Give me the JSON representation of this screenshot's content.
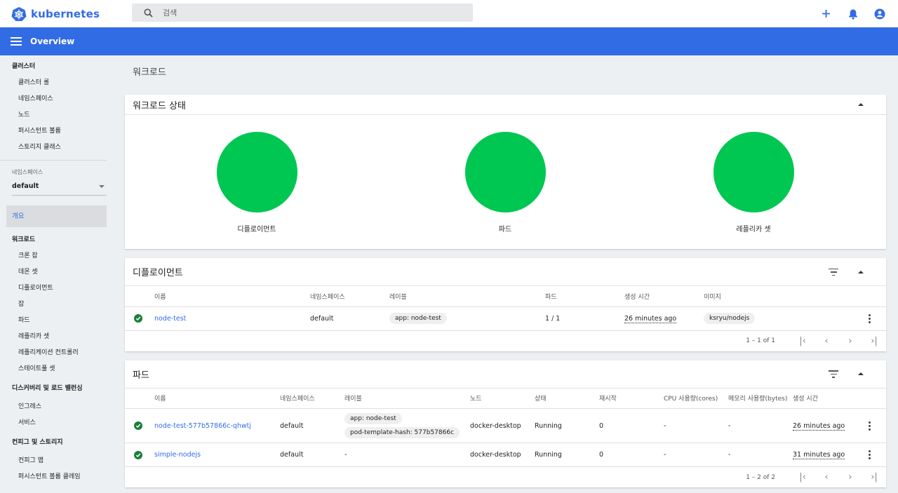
{
  "app": {
    "logo_text": "kubernetes",
    "brand_color": "#326ce5"
  },
  "search": {
    "placeholder": "검색"
  },
  "toolbar": {
    "title": "Overview"
  },
  "sidebar": {
    "cluster_head": "클러스터",
    "cluster_items": [
      "클러스터 롤",
      "네임스페이스",
      "노드",
      "퍼시스턴트 볼륨",
      "스토리지 클래스"
    ],
    "namespace_label": "네임스페이스",
    "namespace_value": "default",
    "active_item": "개요",
    "workload_head": "워크로드",
    "workload_items": [
      "크론 잡",
      "데몬 셋",
      "디플로이먼트",
      "잡",
      "파드",
      "레플리카 셋",
      "레플리케이션 컨트롤러",
      "스테이트풀 셋"
    ],
    "discovery_head": "디스커버리 및 로드 밸런싱",
    "discovery_items": [
      "인그레스",
      "서비스"
    ],
    "config_head": "컨피그 및 스토리지",
    "config_items": [
      "컨피그 맵",
      "퍼시스턴트 볼륨 클레임"
    ]
  },
  "main": {
    "page_title": "워크로드",
    "status_card": {
      "title": "워크로드 상태",
      "status_color": "#00c752",
      "items": [
        "디플로이먼트",
        "파드",
        "레플리카 셋"
      ]
    },
    "deployments": {
      "title": "디플로이먼트",
      "columns": [
        "이름",
        "네임스페이스",
        "레이블",
        "파드",
        "생성 시간",
        "이미지"
      ],
      "rows": [
        {
          "name": "node-test",
          "namespace": "default",
          "label": "app: node-test",
          "pods": "1 / 1",
          "created": "26 minutes ago",
          "image": "ksryu/nodejs"
        }
      ],
      "range": "1 – 1 of 1"
    },
    "pods": {
      "title": "파드",
      "columns": [
        "이름",
        "네임스페이스",
        "레이블",
        "노드",
        "상태",
        "재시작",
        "CPU 사용량(cores)",
        "메모리 사용량(bytes)",
        "생성 시간"
      ],
      "rows": [
        {
          "name": "node-test-577b57866c-qhwtj",
          "namespace": "default",
          "label1": "app: node-test",
          "label2": "pod-template-hash: 577b57866c",
          "node": "docker-desktop",
          "status": "Running",
          "restarts": "0",
          "cpu": "-",
          "memory": "-",
          "created": "26 minutes ago"
        },
        {
          "name": "simple-nodejs",
          "namespace": "default",
          "label1": "-",
          "node": "docker-desktop",
          "status": "Running",
          "restarts": "0",
          "cpu": "-",
          "memory": "-",
          "created": "31 minutes ago"
        }
      ],
      "range": "1 – 2 of 2"
    }
  }
}
